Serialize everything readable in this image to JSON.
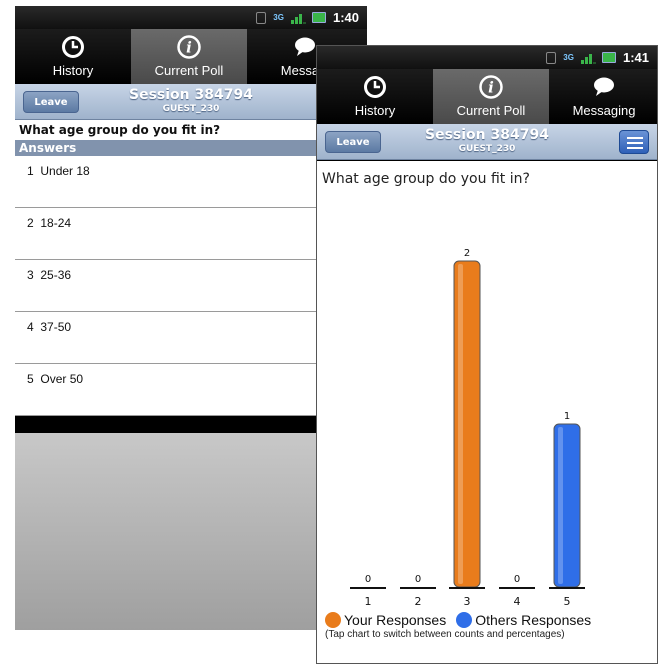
{
  "phone1": {
    "status": {
      "time": "1:40",
      "network": "3G"
    },
    "tabs": [
      {
        "label": "History",
        "icon": "clock-icon"
      },
      {
        "label": "Current Poll",
        "icon": "info-icon"
      },
      {
        "label": "Messagi",
        "icon": "speech-bubble-icon"
      }
    ],
    "header": {
      "leave": "Leave",
      "session": "Session 384794",
      "user": "GUEST_230"
    },
    "question": "What age group do you fit in?",
    "answers_label": "Answers",
    "answers": [
      {
        "num": "1",
        "text": "Under 18"
      },
      {
        "num": "2",
        "text": "18-24"
      },
      {
        "num": "3",
        "text": "25-36"
      },
      {
        "num": "4",
        "text": "37-50"
      },
      {
        "num": "5",
        "text": "Over 50"
      }
    ]
  },
  "phone2": {
    "status": {
      "time": "1:41",
      "network": "3G"
    },
    "tabs": [
      {
        "label": "History",
        "icon": "clock-icon"
      },
      {
        "label": "Current Poll",
        "icon": "info-icon"
      },
      {
        "label": "Messaging",
        "icon": "speech-bubble-icon"
      }
    ],
    "header": {
      "leave": "Leave",
      "session": "Session 384794",
      "user": "GUEST_230"
    },
    "question": "What age group do you fit in?",
    "legend": {
      "your": "Your Responses",
      "others": "Others Responses",
      "note": "(Tap chart to switch between counts and percentages)"
    }
  },
  "colors": {
    "your": "#e97c1c",
    "others": "#2f6ee8",
    "header": "#9fb3cc"
  },
  "chart_data": {
    "type": "bar",
    "categories": [
      "1",
      "2",
      "3",
      "4",
      "5"
    ],
    "values": [
      0,
      0,
      2,
      0,
      1
    ],
    "bar_owner": [
      "none",
      "none",
      "your",
      "none",
      "others"
    ],
    "ylim": [
      0,
      2
    ]
  }
}
